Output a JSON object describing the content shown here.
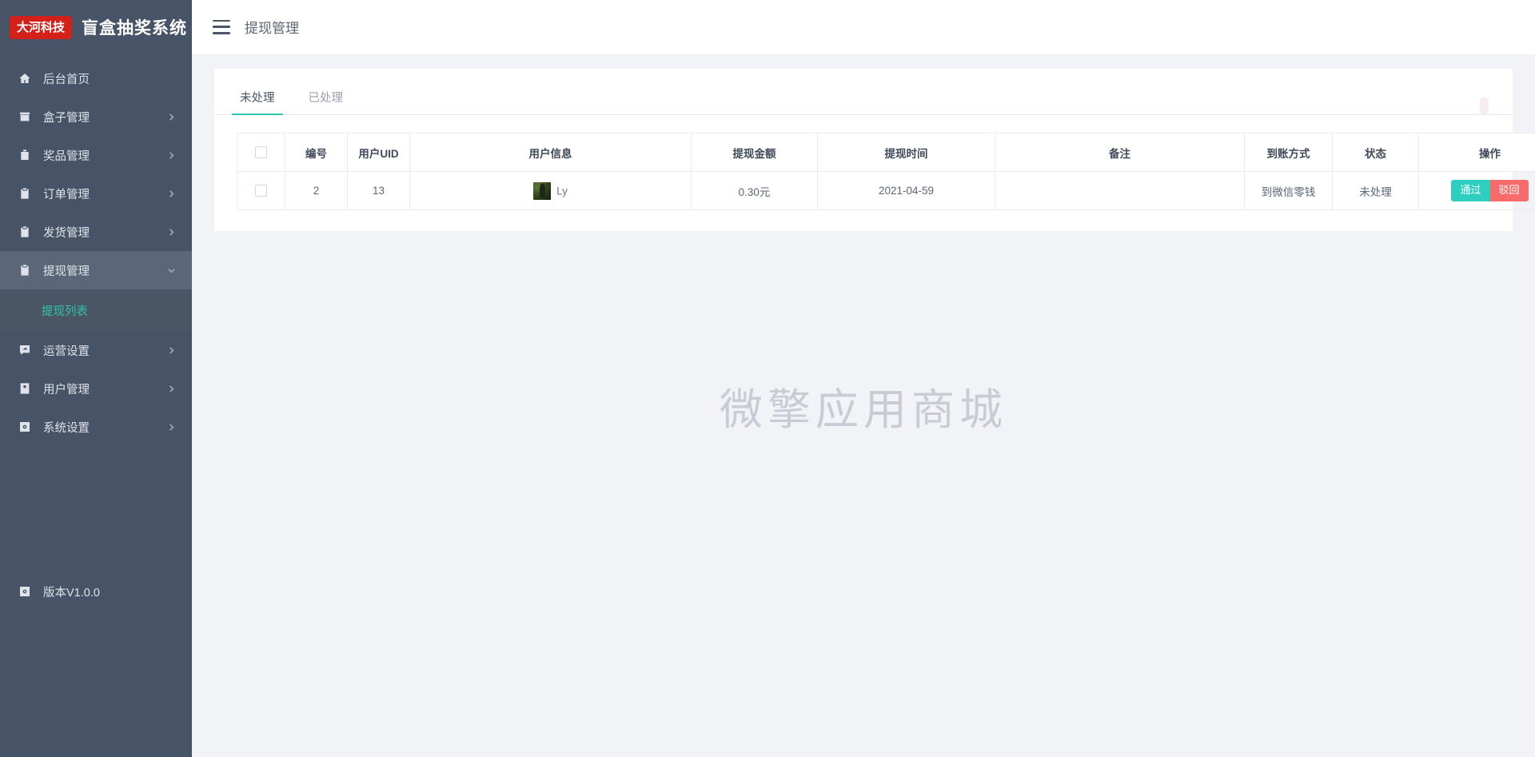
{
  "brand": {
    "badge": "大河科技",
    "title": "盲盒抽奖系统"
  },
  "topbar": {
    "title": "提现管理",
    "menu_icon": "hamburger-icon"
  },
  "sidebar": {
    "items": [
      {
        "label": "后台首页",
        "icon": "home-icon",
        "arrow": "",
        "active": false
      },
      {
        "label": "盒子管理",
        "icon": "box-icon",
        "arrow": "›",
        "active": false
      },
      {
        "label": "奖品管理",
        "icon": "gift-icon",
        "arrow": "›",
        "active": false
      },
      {
        "label": "订单管理",
        "icon": "clipboard-icon",
        "arrow": "›",
        "active": false
      },
      {
        "label": "发货管理",
        "icon": "clipboard-icon",
        "arrow": "›",
        "active": false
      },
      {
        "label": "提现管理",
        "icon": "clipboard-icon",
        "arrow": "⌄",
        "active": true
      },
      {
        "label": "运营设置",
        "icon": "pencil-square-icon",
        "arrow": "›",
        "active": false
      },
      {
        "label": "用户管理",
        "icon": "user-icon",
        "arrow": "›",
        "active": false
      },
      {
        "label": "系统设置",
        "icon": "gear-icon",
        "arrow": "›",
        "active": false
      }
    ],
    "submenu": [
      {
        "label": "提现列表",
        "active": true
      }
    ],
    "version": {
      "label": "版本V1.0.0",
      "icon": "gear-icon"
    }
  },
  "tabs": [
    {
      "label": "未处理",
      "active": true
    },
    {
      "label": "已处理",
      "active": false
    }
  ],
  "table": {
    "columns": [
      "",
      "编号",
      "用户UID",
      "用户信息",
      "提现金额",
      "提现时间",
      "备注",
      "到账方式",
      "状态",
      "操作"
    ],
    "rows": [
      {
        "id": "2",
        "uid": "13",
        "user_name": "Ly",
        "amount": "0.30元",
        "time": "2021-04-59",
        "remark": "",
        "pay_method": "到微信零钱",
        "status": "未处理",
        "actions": [
          {
            "label": "通过",
            "color": "#2ecfc0"
          },
          {
            "label": "驳回",
            "color": "#f76b6b"
          }
        ]
      }
    ]
  },
  "watermark": "微擎应用商城",
  "colors": {
    "sidebar_bg": "#475468",
    "sidebar_active": "#5a6779",
    "submenu_bg": "#4a5566",
    "accent_teal": "#2ec7b0",
    "accent_green_text": "#2fc5a8",
    "brand_red": "#d32119",
    "page_bg": "#f2f3f7",
    "btn_pass": "#2ecfc0",
    "btn_reject": "#f76b6b"
  }
}
